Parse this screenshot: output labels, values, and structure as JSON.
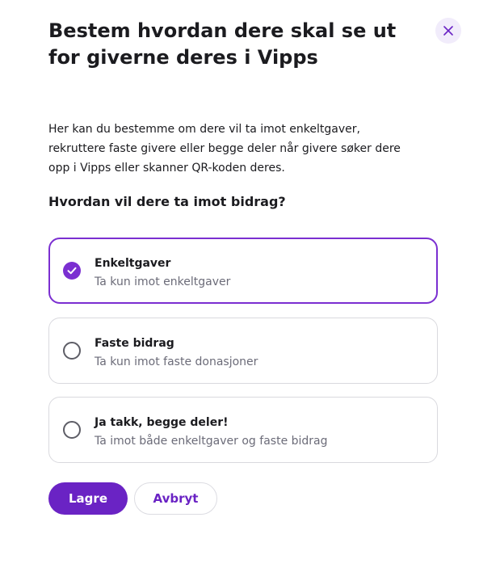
{
  "dialog": {
    "title": "Bestem hvordan dere skal se ut for giverne deres i Vipps",
    "close_icon": "close-icon",
    "description": "Her kan du bestemme om dere vil ta imot enkeltgaver, rekruttere faste givere eller begge deler når givere søker dere opp i Vipps eller skanner QR-koden deres.",
    "question": "Hvordan vil dere ta imot bidrag?"
  },
  "options": [
    {
      "title": "Enkeltgaver",
      "subtitle": "Ta kun imot enkeltgaver",
      "selected": true
    },
    {
      "title": "Faste bidrag",
      "subtitle": "Ta kun imot faste donasjoner",
      "selected": false
    },
    {
      "title": "Ja takk, begge deler!",
      "subtitle": "Ta imot både enkeltgaver og faste bidrag",
      "selected": false
    }
  ],
  "actions": {
    "save_label": "Lagre",
    "cancel_label": "Avbryt"
  },
  "colors": {
    "accent": "#6a23c4",
    "selected_border": "#7b2fd1",
    "close_bg": "#f1ecfb"
  }
}
